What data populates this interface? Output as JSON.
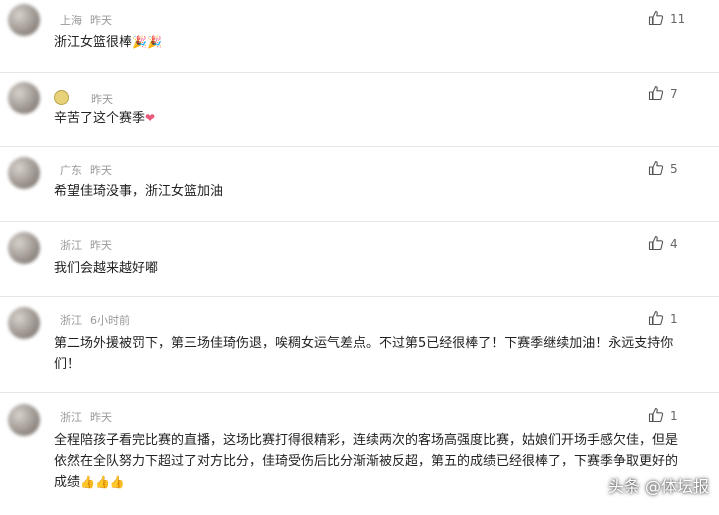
{
  "comments": [
    {
      "name": "",
      "location": "上海",
      "time": "昨天",
      "text": "浙江女篮很棒",
      "emoji": "🎉🎉",
      "likes": "11"
    },
    {
      "name": "",
      "location": "",
      "time": "昨天",
      "text": "辛苦了这个赛季",
      "emoji": "❤",
      "likes": "7"
    },
    {
      "name": "",
      "location": "广东",
      "time": "昨天",
      "text": "希望佳琦没事，浙江女篮加油",
      "likes": "5"
    },
    {
      "name": "",
      "location": "浙江",
      "time": "昨天",
      "text": "我们会越来越好嘟",
      "likes": "4"
    },
    {
      "name": "",
      "location": "浙江",
      "time": "6小时前",
      "text": "第二场外援被罚下，第三场佳琦伤退，唉稠女运气差点。不过第5已经很棒了！下赛季继续加油！永远支持你们！",
      "likes": "1"
    },
    {
      "name": "",
      "location": "浙江",
      "time": "昨天",
      "text": "全程陪孩子看完比赛的直播，这场比赛打得很精彩，连续两次的客场高强度比赛，姑娘们开场手感欠佳，但是依然在全队努力下超过了对方比分，佳琦受伤后比分渐渐被反超，第五的成绩已经很棒了，下赛季争取更好的成绩",
      "emoji": "👍👍👍",
      "likes": "1"
    }
  ],
  "watermark": "头条 @体坛报",
  "colors": {
    "meta": "#999999",
    "text": "#222222",
    "like": "#666666"
  },
  "icons": {
    "like": "thumbs-up-icon",
    "badge": "level-badge-icon"
  }
}
